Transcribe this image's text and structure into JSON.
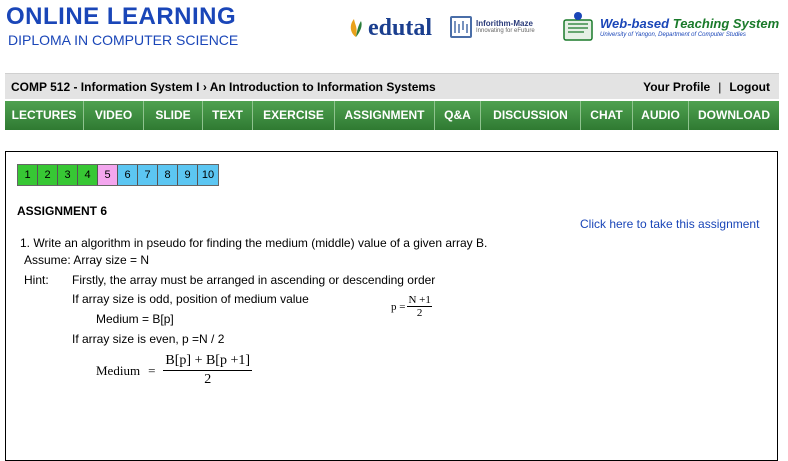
{
  "header": {
    "title": "ONLINE LEARNING",
    "subtitle": "DIPLOMA IN COMPUTER SCIENCE",
    "logos": {
      "edutal": "edutal",
      "inforithm_line1": "Inforithm-Maze",
      "inforithm_line2": "Innovating for eFuture",
      "wbts_title_part1": "Web-based",
      "wbts_title_part2": "Teaching System",
      "wbts_sub": "University of Yangon, Department of Computer Studies"
    }
  },
  "breadcrumb": {
    "text": "COMP 512 - Information System I › An Introduction to Information Systems",
    "profile": "Your Profile",
    "separator": "|",
    "logout": "Logout"
  },
  "nav": {
    "items": [
      "LECTURES",
      "VIDEO",
      "SLIDE",
      "TEXT",
      "EXERCISE",
      "ASSIGNMENT",
      "Q&A",
      "DISCUSSION",
      "CHAT",
      "AUDIO",
      "DOWNLOAD"
    ]
  },
  "pagination": {
    "pages": [
      "1",
      "2",
      "3",
      "4",
      "5",
      "6",
      "7",
      "8",
      "9",
      "10"
    ],
    "current": "5"
  },
  "assignment": {
    "title": "ASSIGNMENT 6",
    "take_link": "Click here to take this assignment",
    "question": "1. Write an algorithm in pseudo for finding the medium (middle) value of a given array B.",
    "assume": "Assume: Array size = N",
    "hint_label": "Hint:",
    "hint_text": "Firstly, the array must be arranged in ascending or descending order",
    "odd_text": "If array size is odd, position of medium value",
    "medium_odd": "Medium = B[p]",
    "even_text": "If array size is even, p =N / 2",
    "formula_p_lhs": "p =",
    "formula_p_num": "N +1",
    "formula_p_den": "2",
    "formula_med_lhs": "Medium",
    "formula_med_eq": "=",
    "formula_med_num": "B[p] + B[p +1]",
    "formula_med_den": "2"
  },
  "colors": {
    "brand_blue": "#1a46b8",
    "nav_green": "#3c8a3e",
    "page_done": "#37c734",
    "page_current": "#f3a6ee",
    "page_todo": "#5cc6f2"
  }
}
